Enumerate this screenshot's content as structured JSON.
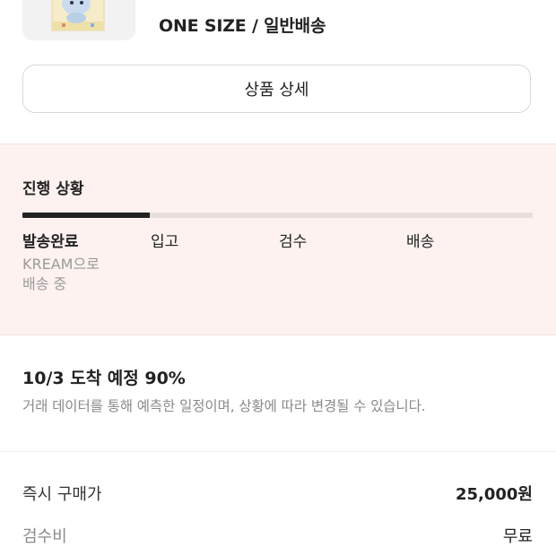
{
  "product": {
    "option_text": "ONE SIZE / 일반배송",
    "detail_button_label": "상품 상세"
  },
  "progress": {
    "title": "진행 상황",
    "fill_fraction": 0.25,
    "steps": [
      {
        "label": "발송완료",
        "active": true
      },
      {
        "label": "입고",
        "active": false
      },
      {
        "label": "검수",
        "active": false
      },
      {
        "label": "배송",
        "active": false
      }
    ],
    "active_step_description": "KREAM으로\n배송 중"
  },
  "eta": {
    "title": "10/3 도착 예정 90%",
    "description": "거래 데이터를 통해 예측한 일정이며, 상황에 따라 변경될 수 있습니다."
  },
  "price_rows": [
    {
      "label": "즉시 구매가",
      "value": "25,000원"
    },
    {
      "label": "검수비",
      "value": "무료"
    }
  ],
  "colors": {
    "section_background": "#fdf2f0",
    "progress_fill": "#222222",
    "progress_track": "#e8dedc",
    "muted_text": "#8a8a8a"
  }
}
